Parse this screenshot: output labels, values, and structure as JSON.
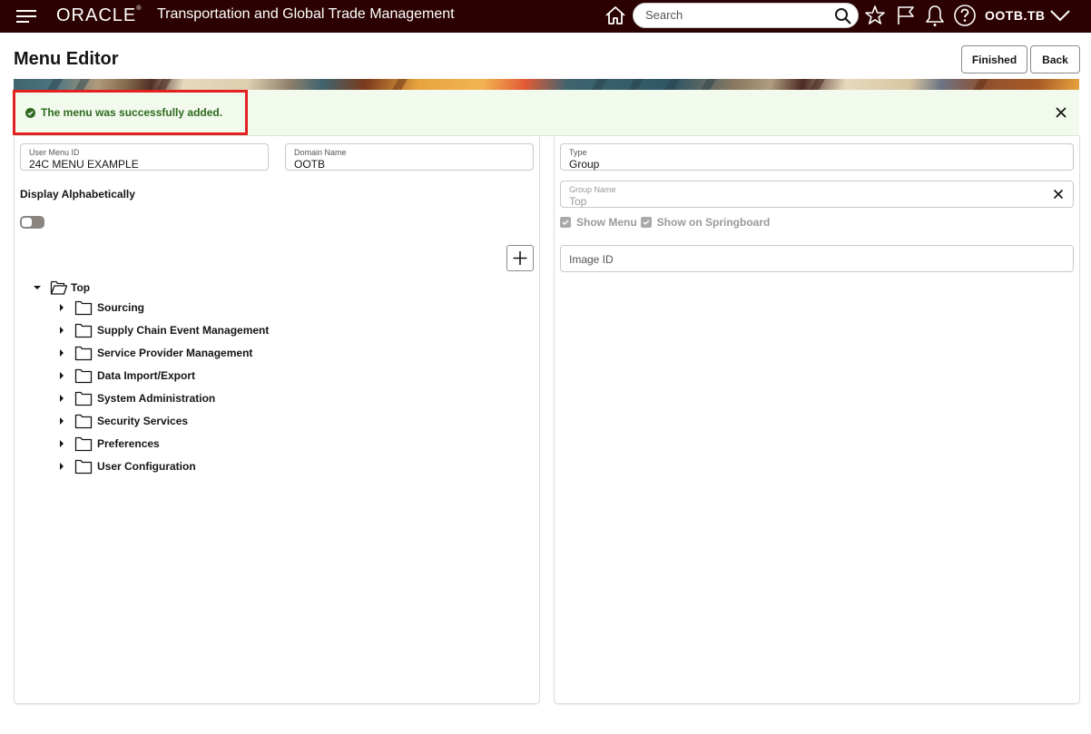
{
  "header": {
    "brand": "ORACLE",
    "app_title": "Transportation and Global Trade Management",
    "search_placeholder": "Search",
    "user": "OOTB.TB",
    "icons": [
      "menu-icon",
      "home-icon",
      "search-icon",
      "star-icon",
      "flag-icon",
      "bell-icon",
      "help-icon",
      "chevron-down-icon"
    ]
  },
  "page": {
    "title": "Menu Editor",
    "buttons": {
      "finished": "Finished",
      "back": "Back"
    }
  },
  "message": {
    "text": "The menu was successfully added.",
    "type": "success",
    "color": "#2f6a20",
    "background": "#f1faec",
    "highlight_color": "#e32121"
  },
  "left_panel": {
    "user_menu_id": {
      "label": "User Menu ID",
      "value": "24C MENU EXAMPLE"
    },
    "domain_name": {
      "label": "Domain Name",
      "value": "OOTB"
    },
    "display_alphabetically": {
      "label": "Display Alphabetically",
      "on": false
    },
    "tree": {
      "root": {
        "label": "Top",
        "expanded": true
      },
      "children": [
        {
          "label": "Sourcing"
        },
        {
          "label": "Supply Chain Event Management"
        },
        {
          "label": "Service Provider Management"
        },
        {
          "label": "Data Import/Export"
        },
        {
          "label": "System Administration"
        },
        {
          "label": "Security Services"
        },
        {
          "label": "Preferences"
        },
        {
          "label": "User Configuration"
        }
      ]
    }
  },
  "right_panel": {
    "type": {
      "label": "Type",
      "value": "Group"
    },
    "group_name": {
      "label": "Group Name",
      "value": "Top"
    },
    "show_menu": {
      "label": "Show Menu",
      "checked": true
    },
    "show_on_springboard": {
      "label": "Show on Springboard",
      "checked": true
    },
    "image_id": {
      "placeholder": "Image ID",
      "value": ""
    }
  }
}
